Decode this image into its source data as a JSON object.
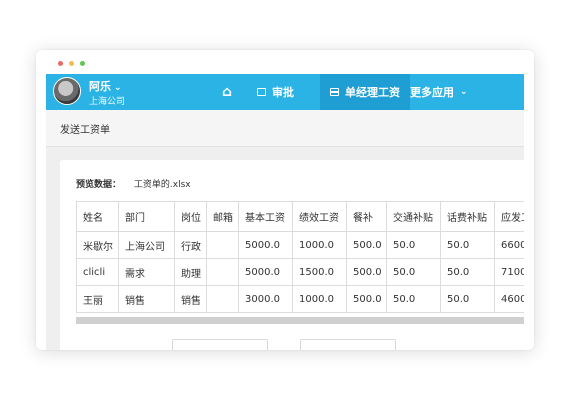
{
  "window": {
    "dots": [
      "red",
      "yellow",
      "green"
    ]
  },
  "navbar": {
    "username": "阿乐",
    "company": "上海公司",
    "items": [
      {
        "label": "",
        "icon": "home-icon"
      },
      {
        "label": "审批",
        "icon": "approve-icon"
      },
      {
        "label": "单经理工资",
        "icon": "salary-icon",
        "active": true
      },
      {
        "label": "更多应用",
        "icon": "chevron-down-icon"
      }
    ],
    "colors": {
      "bar": "#2bb3e6",
      "active": "#1e9ed3"
    }
  },
  "page": {
    "title": "发送工资单"
  },
  "preview": {
    "label": "预览数据：",
    "filename": "工资单的.xlsx"
  },
  "table": {
    "headers": [
      "姓名",
      "部门",
      "岗位",
      "邮箱",
      "基本工资",
      "绩效工资",
      "餐补",
      "交通补贴",
      "话费补贴",
      "应发工"
    ],
    "rows": [
      [
        "米歇尔",
        "上海公司",
        "行政",
        "",
        "5000.0",
        "1000.0",
        "500.0",
        "50.0",
        "50.0",
        "6600"
      ],
      [
        "clicli",
        "需求",
        "助理",
        "",
        "5000.0",
        "1500.0",
        "500.0",
        "50.0",
        "50.0",
        "7100"
      ],
      [
        "王丽",
        "销售",
        "销售",
        "",
        "3000.0",
        "1000.0",
        "500.0",
        "50.0",
        "50.0",
        "4600"
      ]
    ]
  }
}
